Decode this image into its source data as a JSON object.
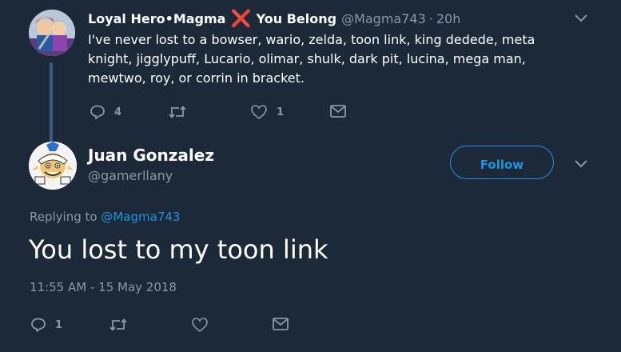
{
  "parent": {
    "name_part1": "Loyal Hero•Magma",
    "name_part2": "You Belong",
    "cross": "❌",
    "handle": "@Magma743",
    "separator": "·",
    "time": "20h",
    "text": "I've never lost to a bowser, wario, zelda, toon link, king dedede, meta knight, jigglypuff, Lucario, olimar, shulk, dark pit, lucina, mega man, mewtwo, roy, or corrin in bracket.",
    "reply_count": "4",
    "retweet_count": "",
    "like_count": "1"
  },
  "reply": {
    "name": "Juan Gonzalez",
    "handle": "@gamerllany",
    "follow_label": "Follow",
    "replying_to_prefix": "Replying to",
    "replying_to_handle": "@Magma743",
    "text": "You lost to my toon link",
    "timestamp": "11:55 AM - 15 May 2018",
    "reply_count": "1",
    "retweet_count": "",
    "like_count": ""
  },
  "colors": {
    "background": "#1c2938",
    "accent": "#1b95e0",
    "muted": "#8899a6",
    "cross": "#e0245e"
  },
  "icons": {
    "reply": "reply-icon",
    "retweet": "retweet-icon",
    "like": "heart-icon",
    "message": "envelope-icon",
    "caret": "chevron-down-icon"
  }
}
